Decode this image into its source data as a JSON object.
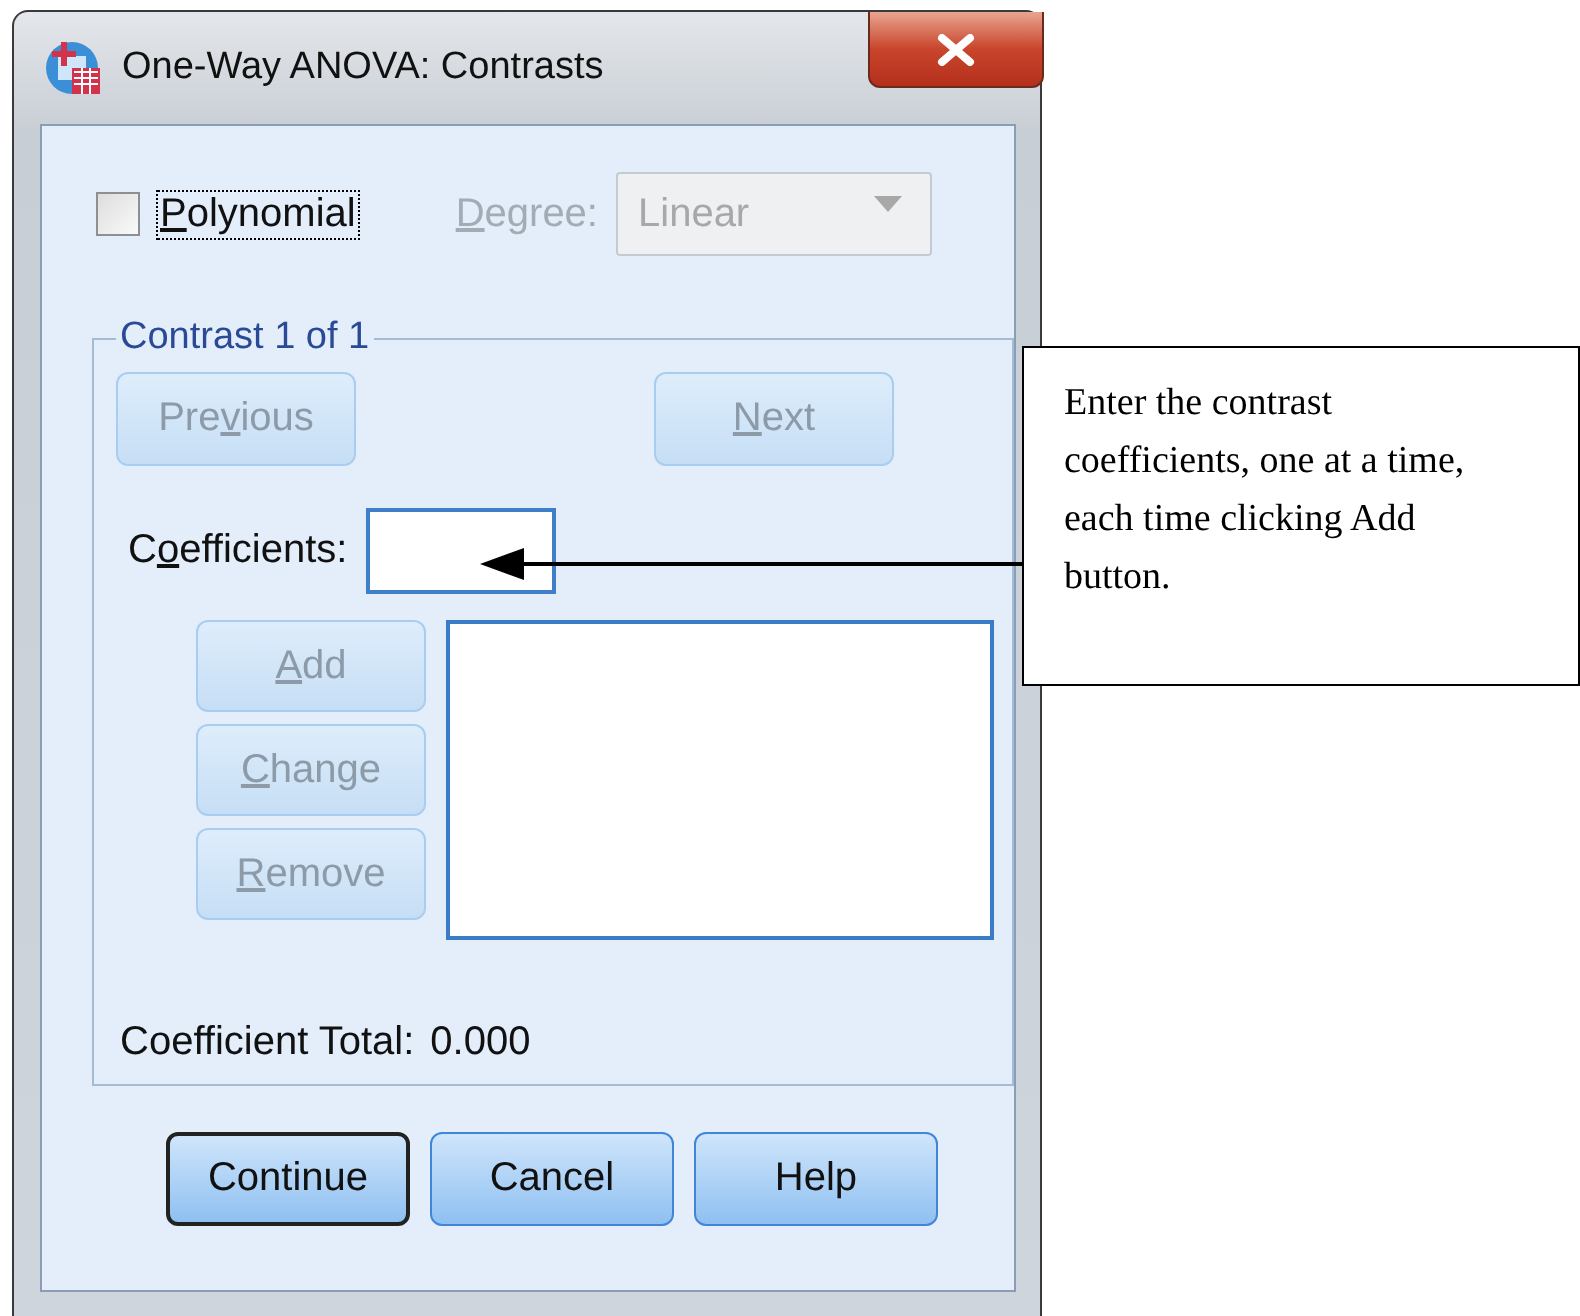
{
  "window": {
    "title": "One-Way ANOVA: Contrasts"
  },
  "polynomial": {
    "label": {
      "key": "P",
      "after": "olynomial"
    },
    "checked": false,
    "focused": true
  },
  "degree": {
    "label": {
      "key": "D",
      "after": "egree:"
    },
    "value": "Linear",
    "disabled": true
  },
  "contrast_group": {
    "title": "Contrast 1 of 1",
    "nav_buttons": [
      {
        "label": {
          "before": "Pre",
          "key": "v",
          "after": "ious"
        },
        "disabled": true
      },
      {
        "label": {
          "key": "N",
          "after": "ext"
        },
        "disabled": true
      }
    ],
    "coefficients": {
      "label": {
        "before": "C",
        "key": "o",
        "after": "efficients:"
      }
    },
    "edit_buttons": [
      {
        "label": {
          "key": "A",
          "after": "dd"
        },
        "disabled": true
      },
      {
        "label": {
          "key": "C",
          "after": "hange"
        },
        "disabled": true
      },
      {
        "label": {
          "key": "R",
          "after": "emove"
        },
        "disabled": true
      }
    ],
    "total": {
      "label": "Coefficient Total:",
      "value": "0.000"
    }
  },
  "buttons": [
    {
      "label": "Continue",
      "default": true
    },
    {
      "label": "Cancel",
      "default": false
    },
    {
      "label": "Help",
      "default": false
    }
  ],
  "callout": {
    "text": "Enter the contrast coefficients, one at a time, each time clicking Add button."
  }
}
